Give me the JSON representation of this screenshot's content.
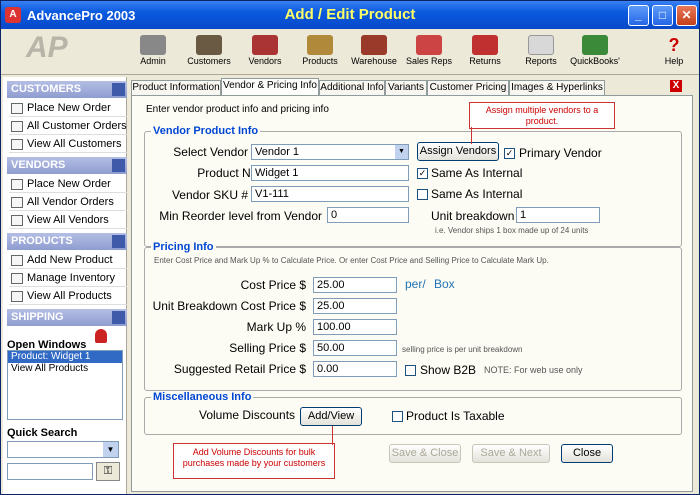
{
  "window": {
    "app_title": "AdvancePro 2003",
    "form_title": "Add / Edit Product"
  },
  "toolbar": {
    "items": [
      {
        "label": "Admin",
        "icon": "admin-icon"
      },
      {
        "label": "Customers",
        "icon": "customers-icon"
      },
      {
        "label": "Vendors",
        "icon": "vendors-icon"
      },
      {
        "label": "Products",
        "icon": "products-icon"
      },
      {
        "label": "Warehouse",
        "icon": "warehouse-icon"
      },
      {
        "label": "Sales Reps",
        "icon": "sales-reps-icon"
      },
      {
        "label": "Returns",
        "icon": "returns-icon"
      },
      {
        "label": "Reports",
        "icon": "reports-icon"
      },
      {
        "label": "QuickBooks'",
        "icon": "quickbooks-icon"
      },
      {
        "label": "Help",
        "icon": "help-icon"
      }
    ]
  },
  "sidebar": {
    "customers": {
      "title": "CUSTOMERS",
      "items": [
        "Place New Order",
        "All Customer Orders",
        "View All Customers"
      ]
    },
    "vendors": {
      "title": "VENDORS",
      "items": [
        "Place New Order",
        "All Vendor Orders",
        "View All Vendors"
      ]
    },
    "products": {
      "title": "PRODUCTS",
      "items": [
        "Add New Product",
        "Manage Inventory",
        "View All Products"
      ]
    },
    "shipping": {
      "title": "SHIPPING"
    },
    "open_windows": {
      "title": "Open Windows",
      "items": [
        "Product: Widget 1",
        "View All Products"
      ]
    },
    "quick_search": {
      "title": "Quick Search"
    }
  },
  "tabs": [
    "Product Information",
    "Vendor & Pricing Info",
    "Additional Info",
    "Variants",
    "Customer Pricing",
    "Images & Hyperlinks"
  ],
  "form": {
    "intro": "Enter vendor product info and pricing info",
    "vendor_group": "Vendor Product Info",
    "select_vendor_label": "Select Vendor",
    "select_vendor_value": "Vendor 1",
    "assign_vendors_button": "Assign Vendors",
    "primary_vendor_label": "Primary Vendor",
    "product_name_label": "Product Name",
    "product_name_value": "Widget 1",
    "same_as_internal_1": "Same As Internal",
    "vendor_sku_label": "Vendor SKU #",
    "vendor_sku_value": "V1-111",
    "same_as_internal_2": "Same As Internal",
    "min_reorder_label": "Min Reorder level from Vendor",
    "min_reorder_value": "0",
    "unit_breakdown_label": "Unit breakdown",
    "unit_breakdown_value": "1",
    "unit_breakdown_note": "i.e. Vendor ships 1 box made up of 24 units",
    "pricing_group": "Pricing Info",
    "pricing_intro": "Enter Cost Price and Mark Up % to Calculate Price.  Or enter Cost Price and Selling Price to Calculate Mark Up.",
    "cost_price_label": "Cost Price $",
    "cost_price_value": "25.00",
    "per_label": "per/",
    "per_unit": "Box",
    "unit_cost_label": "Unit Breakdown Cost Price $",
    "unit_cost_value": "25.00",
    "markup_label": "Mark Up %",
    "markup_value": "100.00",
    "selling_label": "Selling Price $",
    "selling_value": "50.00",
    "selling_note": "selling price is per unit breakdown",
    "retail_label": "Suggested Retail Price $",
    "retail_value": "0.00",
    "show_b2b_label": "Show B2B",
    "b2b_note": "NOTE: For web use only",
    "misc_group": "Miscellaneous Info",
    "volume_label": "Volume Discounts",
    "add_view_button": "Add/View",
    "taxable_label": "Product Is Taxable",
    "save_close": "Save & Close",
    "save_next": "Save & Next",
    "close": "Close"
  },
  "callouts": {
    "assign": "Assign multiple vendors to a product.",
    "volume": "Add Volume Discounts for bulk purchases made by your customers"
  },
  "colors": {
    "title_bar": "#0a5adf",
    "title_text": "#ffff66",
    "group_label": "#0046d5",
    "callout": "#cc0000"
  }
}
